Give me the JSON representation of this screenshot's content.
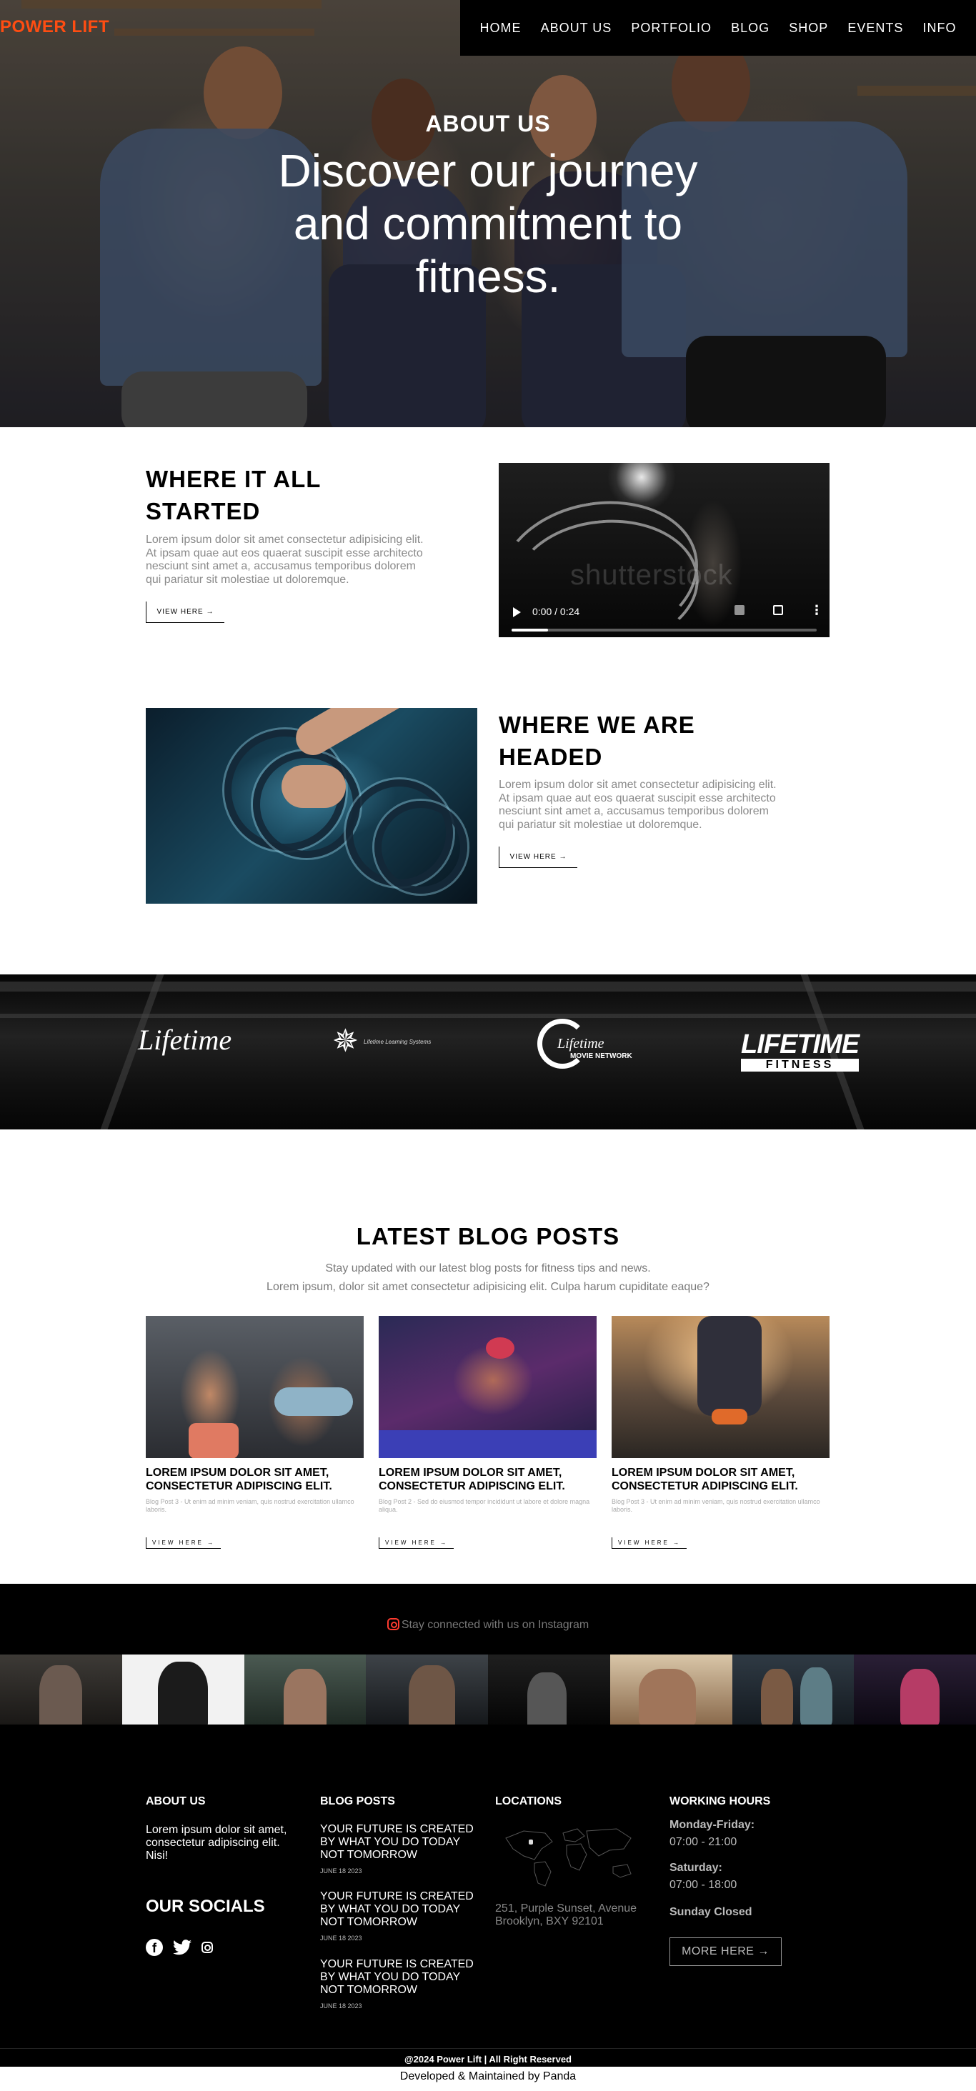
{
  "brand": {
    "name": "POWER LIFT",
    "color": "#ff4d12"
  },
  "nav": {
    "items": [
      "HOME",
      "ABOUT US",
      "PORTFOLIO",
      "BLOG",
      "SHOP",
      "EVENTS",
      "INFO"
    ]
  },
  "hero": {
    "kicker": "ABOUT US",
    "title": "Discover our journey and commitment to fitness."
  },
  "started": {
    "title_line1": "WHERE IT ALL",
    "title_line2": "STARTED",
    "text": "Lorem ipsum dolor sit amet consectetur adipisicing elit. At ipsam quae aut eos quaerat suscipit esse architecto nesciunt sint amet a, accusamus temporibus dolorem qui pariatur sit molestiae ut doloremque.",
    "button": "VIEW HERE →",
    "video": {
      "time": "0:00 / 0:24",
      "watermark": "shutterstock",
      "progress": 0.12,
      "icons": [
        "play-icon",
        "volume-icon",
        "fullscreen-icon",
        "more-options-icon"
      ]
    }
  },
  "headed": {
    "title_line1": "WHERE WE ARE",
    "title_line2": "HEADED",
    "text": "Lorem ipsum dolor sit amet consectetur adipisicing elit. At ipsam quae aut eos quaerat suscipit esse architecto nesciunt sint amet a, accusamus temporibus dolorem qui pariatur sit molestiae ut doloremque.",
    "button": "VIEW HERE →"
  },
  "partners": {
    "lifetime": "Lifetime",
    "star_caption": "Lifetime Learning Systems",
    "network_main": "Lifetime",
    "network_sub": "MOVIE NETWORK",
    "ltf_main": "LIFETIME",
    "ltf_sub": "FITNESS"
  },
  "blog": {
    "heading": "LATEST BLOG POSTS",
    "sub1": "Stay updated with our latest blog posts for fitness tips and news.",
    "sub2": "Lorem ipsum, dolor sit amet consectetur adipisicing elit. Culpa harum cupiditate eaque?",
    "posts": [
      {
        "title": "LOREM IPSUM DOLOR SIT AMET, CONSECTETUR ADIPISCING ELIT.",
        "excerpt": "Blog Post 3 - Ut enim ad minim veniam, quis nostrud exercitation ullamco laboris.",
        "button": "VIEW HERE →"
      },
      {
        "title": "LOREM IPSUM DOLOR SIT AMET, CONSECTETUR ADIPISCING ELIT.",
        "excerpt": "Blog Post 2 - Sed do eiusmod tempor incididunt ut labore et dolore magna aliqua.",
        "button": "VIEW HERE →"
      },
      {
        "title": "LOREM IPSUM DOLOR SIT AMET, CONSECTETUR ADIPISCING ELIT.",
        "excerpt": "Blog Post 3 - Ut enim ad minim veniam, quis nostrud exercitation ullamco laboris.",
        "button": "VIEW HERE →"
      }
    ]
  },
  "instagram": {
    "label": "Stay connected with us on Instagram"
  },
  "footer": {
    "about_head": "ABOUT US",
    "about_text": "Lorem ipsum dolor sit amet, consectetur adipiscing elit. Nisi!",
    "socials_head": "OUR SOCIALS",
    "social_icons": [
      "facebook-icon",
      "twitter-icon",
      "instagram-icon"
    ],
    "blog_head": "BLOG POSTS",
    "blog_posts": [
      {
        "title": "YOUR FUTURE IS CREATED BY WHAT YOU DO TODAY NOT TOMORROW",
        "date": "JUNE 18 2023"
      },
      {
        "title": "YOUR FUTURE IS CREATED BY WHAT YOU DO TODAY NOT TOMORROW",
        "date": "JUNE 18 2023"
      },
      {
        "title": "YOUR FUTURE IS CREATED BY WHAT YOU DO TODAY NOT TOMORROW",
        "date": "JUNE 18 2023"
      }
    ],
    "locations_head": "LOCATIONS",
    "address": "251, Purple Sunset, Avenue Brooklyn, BXY 92101",
    "hours_head": "WORKING HOURS",
    "weekday_label": "Monday-Friday:",
    "weekday_hours": "07:00 - 21:00",
    "saturday_label": "Saturday:",
    "saturday_hours": "07:00 - 18:00",
    "sunday": "Sunday Closed",
    "more_button": "MORE HERE →",
    "copyright": "@2024 Power Lift | All Right Reserved",
    "developed": "Developed & Maintained by Panda"
  }
}
